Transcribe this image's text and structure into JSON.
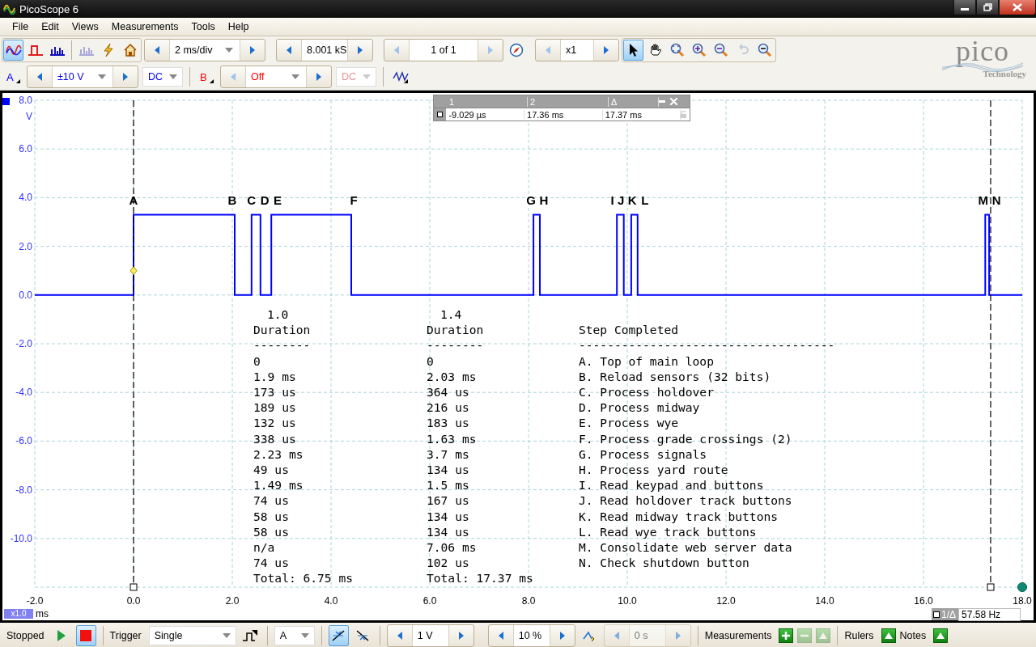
{
  "window": {
    "title": "PicoScope 6"
  },
  "menu": [
    "File",
    "Edit",
    "Views",
    "Measurements",
    "Tools",
    "Help"
  ],
  "toolbar": {
    "modes": [
      {
        "kind": "scope",
        "selected": true
      },
      {
        "kind": "persistence",
        "selected": false
      },
      {
        "kind": "spectrum",
        "selected": false
      }
    ],
    "actions": [
      {
        "kind": "spectrum-persistence",
        "disabled": true
      },
      {
        "kind": "lightning",
        "disabled": false
      },
      {
        "kind": "home",
        "disabled": false
      }
    ],
    "timebase": "2 ms/div",
    "samples": "8.001 kS",
    "buffer": "1 of 1",
    "zoom": "x1",
    "tools": [
      {
        "kind": "pointer",
        "selected": true,
        "disabled": false
      },
      {
        "kind": "hand",
        "selected": false,
        "disabled": false
      },
      {
        "kind": "zoom-area",
        "selected": false,
        "disabled": false
      },
      {
        "kind": "zoom-in",
        "selected": false,
        "disabled": false
      },
      {
        "kind": "zoom-out",
        "selected": false,
        "disabled": false
      },
      {
        "kind": "undo",
        "selected": false,
        "disabled": true
      },
      {
        "kind": "zoom-fit",
        "selected": false,
        "disabled": false
      }
    ]
  },
  "logo": {
    "name": "pico",
    "tagline": "Technology"
  },
  "channels": [
    {
      "name": "A",
      "range": "±10 V",
      "coupling": "DC",
      "enabled": true,
      "color": "#0000ff"
    },
    {
      "name": "B",
      "range": "Off",
      "coupling": "DC",
      "enabled": false,
      "color": "#ff0000"
    }
  ],
  "plot": {
    "chart_data": {
      "type": "line",
      "xlabel": "ms",
      "ylabel": "V",
      "x": [
        -2,
        0,
        0,
        2.05,
        2.05,
        2.39,
        2.39,
        2.57,
        2.57,
        2.79,
        2.79,
        4.41,
        4.41,
        8.1,
        8.1,
        8.23,
        8.23,
        9.79,
        9.79,
        9.93,
        9.93,
        10.08,
        10.08,
        10.21,
        10.21,
        17.25,
        17.25,
        17.33,
        17.33,
        18
      ],
      "series": [
        {
          "color": "#0000ff",
          "values": [
            0,
            0,
            3.3,
            3.3,
            0,
            0,
            3.3,
            3.3,
            0,
            0,
            3.3,
            3.3,
            0,
            0,
            3.3,
            3.3,
            0,
            0,
            3.3,
            3.3,
            0,
            0,
            3.3,
            3.3,
            0,
            0,
            3.3,
            3.3,
            0,
            0
          ]
        }
      ],
      "xlim": [
        -2,
        18
      ],
      "ylim": [
        -12,
        8
      ],
      "xticks": [
        {
          "value": -2,
          "label": "-2.0"
        },
        {
          "value": 0,
          "label": "0.0"
        },
        {
          "value": 2,
          "label": "2.0"
        },
        {
          "value": 4,
          "label": "4.0"
        },
        {
          "value": 6,
          "label": "6.0"
        },
        {
          "value": 8,
          "label": "8.0"
        },
        {
          "value": 10,
          "label": "10.0"
        },
        {
          "value": 12,
          "label": "12.0"
        },
        {
          "value": 14,
          "label": "14.0"
        },
        {
          "value": 16,
          "label": "16.0"
        },
        {
          "value": 18,
          "label": "18.0"
        }
      ],
      "yticks": [
        {
          "value": 8,
          "label": "8.0"
        },
        {
          "value": 6,
          "label": "6.0"
        },
        {
          "value": 4,
          "label": "4.0"
        },
        {
          "value": 2,
          "label": "2.0"
        },
        {
          "value": 0,
          "label": "0.0"
        },
        {
          "value": -2,
          "label": "-2.0"
        },
        {
          "value": -4,
          "label": "-4.0"
        },
        {
          "value": -6,
          "label": "-6.0"
        },
        {
          "value": -8,
          "label": "-8.0"
        },
        {
          "value": -10,
          "label": "-10.0"
        }
      ],
      "grid": true,
      "ref_lines": [
        {
          "axis": "x",
          "value": 0
        },
        {
          "axis": "x",
          "value": 17.36
        }
      ],
      "annotations": [
        "A",
        "B",
        "C",
        "D",
        "E",
        "F",
        "G",
        "H",
        "I",
        "J",
        "K",
        "L",
        "M",
        "N"
      ]
    },
    "zoom_factor": "x1.0",
    "rulers_table": {
      "headers": [
        "1",
        "2",
        "Δ"
      ],
      "values": [
        "-9.029 µs",
        "17.36 ms",
        "17.37 ms"
      ]
    },
    "frequency": {
      "label": "1/Δ",
      "value": "57.58 Hz"
    },
    "notes": {
      "durations": [
        {
          "version": "1.0",
          "heading": "Duration",
          "rule": "--------",
          "rows": [
            "0",
            "1.9 ms",
            "173 us",
            "189 us",
            "132 us",
            "338 us",
            "2.23 ms",
            "49 us",
            "1.49 ms",
            "74 us",
            "58 us",
            "58 us",
            "n/a",
            "74 us"
          ],
          "total": "Total: 6.75 ms"
        },
        {
          "version": "1.4",
          "heading": "Duration",
          "rule": "--------",
          "rows": [
            "0",
            "2.03 ms",
            "364 us",
            "216 us",
            "183 us",
            "1.63 ms",
            "3.7 ms",
            "134 us",
            "1.5 ms",
            "167 us",
            "134 us",
            "134 us",
            "7.06 ms",
            "102 us"
          ],
          "total": "Total: 17.37 ms"
        }
      ],
      "steps": {
        "heading": "Step Completed",
        "rule": "------------------------------------",
        "items": [
          "A. Top of main loop",
          "B. Reload sensors (32 bits)",
          "C. Process holdover",
          "D. Process midway",
          "E. Process wye",
          "F. Process grade crossings (2)",
          "G. Process signals",
          "H. Process yard route",
          "I. Read keypad and buttons",
          "J. Read holdover track buttons",
          "K. Read midway track buttons",
          "L. Read wye track buttons",
          "M. Consolidate web server data",
          "N. Check shutdown button"
        ]
      }
    }
  },
  "status_bar": {
    "state": "Stopped",
    "run_buttons": [
      {
        "kind": "play",
        "selected": false
      },
      {
        "kind": "stop",
        "selected": true
      }
    ],
    "trigger_label": "Trigger",
    "trigger_mode": "Single",
    "trigger_source": "A",
    "edges": [
      {
        "kind": "rising",
        "selected": true
      },
      {
        "kind": "falling",
        "selected": false
      }
    ],
    "threshold": "1 V",
    "pretrigger": "10 %",
    "delay": {
      "value": "0 s",
      "disabled": true
    },
    "measurements": {
      "label": "Measurements",
      "buttons": [
        {
          "kind": "add",
          "disabled": false
        },
        {
          "kind": "remove",
          "disabled": true
        },
        {
          "kind": "edit",
          "disabled": true
        }
      ]
    },
    "rulers_label": "Rulers",
    "notes_label": "Notes"
  }
}
